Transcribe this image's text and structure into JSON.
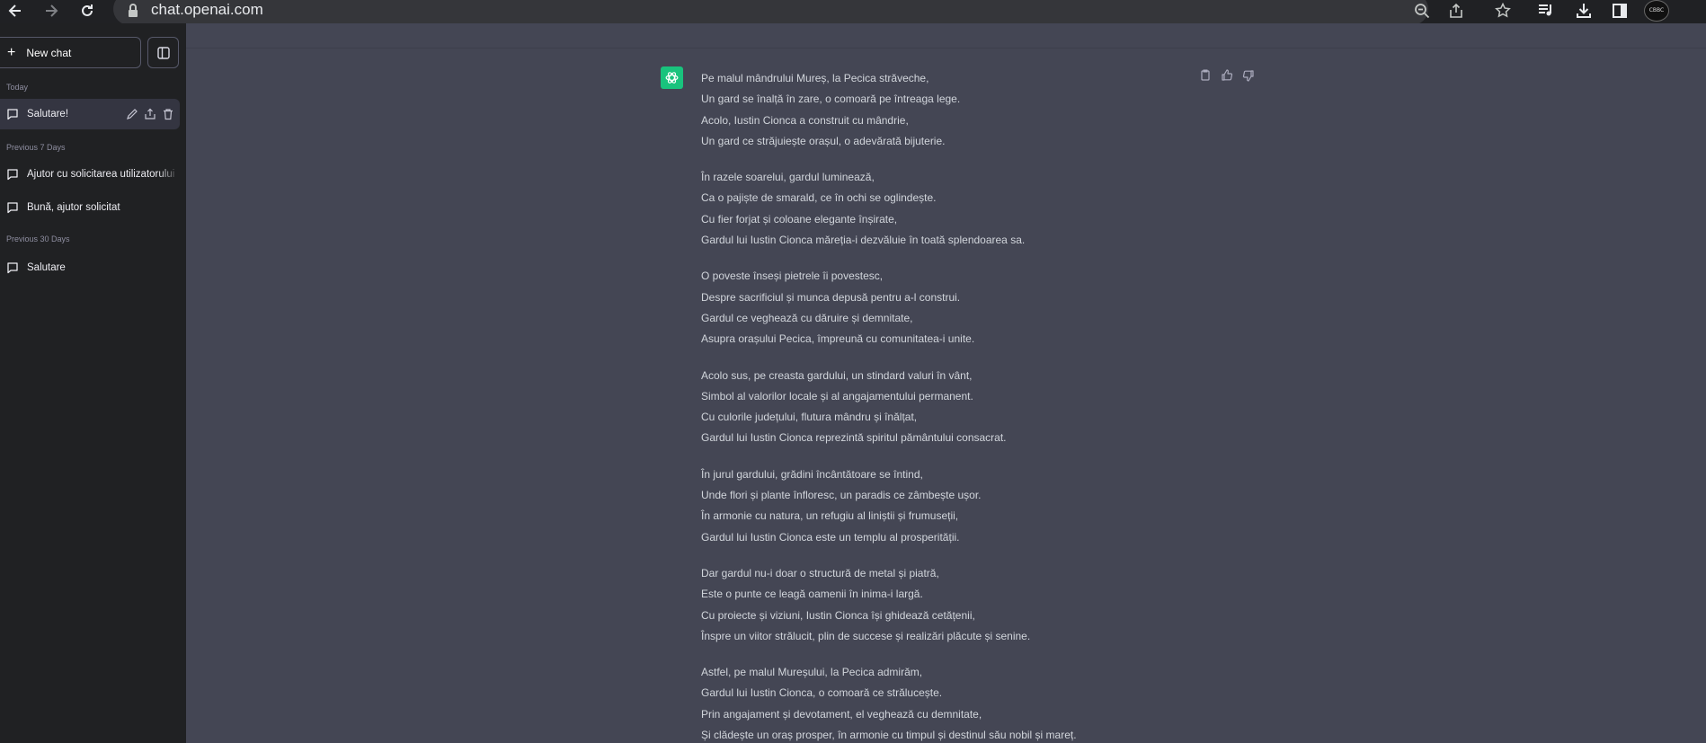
{
  "browser": {
    "url": "chat.openai.com",
    "profile_label": "CBBC"
  },
  "sidebar": {
    "new_chat_label": "New chat",
    "groups": [
      {
        "label": "Today",
        "items": [
          {
            "label": "Salutare!"
          }
        ]
      },
      {
        "label": "Previous 7 Days",
        "items": [
          {
            "label": "Ajutor cu solicitarea utilizatorului"
          },
          {
            "label": "Bună, ajutor solicitat"
          }
        ]
      },
      {
        "label": "Previous 30 Days",
        "items": [
          {
            "label": "Salutare"
          }
        ]
      }
    ]
  },
  "message": {
    "stanzas": [
      [
        "Pe malul mândrului Mureș, la Pecica străveche,",
        "Un gard se înalță în zare, o comoară pe întreaga lege.",
        "Acolo, Iustin Cionca a construit cu mândrie,",
        "Un gard ce străjuiește orașul, o adevărată bijuterie."
      ],
      [
        "În razele soarelui, gardul luminează,",
        "Ca o pajiște de smarald, ce în ochi se oglindește.",
        "Cu fier forjat și coloane elegante înșirate,",
        "Gardul lui Iustin Cionca măreția-i dezvăluie în toată splendoarea sa."
      ],
      [
        "O poveste înseși pietrele îi povestesc,",
        "Despre sacrificiul și munca depusă pentru a-l construi.",
        "Gardul ce veghează cu dăruire și demnitate,",
        "Asupra orașului Pecica, împreună cu comunitatea-i unite."
      ],
      [
        "Acolo sus, pe creasta gardului, un stindard valuri în vânt,",
        "Simbol al valorilor locale și al angajamentului permanent.",
        "Cu culorile județului, flutura mândru și înălțat,",
        "Gardul lui Iustin Cionca reprezintă spiritul pământului consacrat."
      ],
      [
        "În jurul gardului, grădini încântătoare se întind,",
        "Unde flori și plante înfloresc, un paradis ce zâmbește ușor.",
        "În armonie cu natura, un refugiu al liniștii și frumuseții,",
        "Gardul lui Iustin Cionca este un templu al prosperității."
      ],
      [
        "Dar gardul nu-i doar o structură de metal și piatră,",
        "Este o punte ce leagă oamenii în inima-i largă.",
        "Cu proiecte și viziuni, Iustin Cionca își ghidează cetățenii,",
        "Înspre un viitor strălucit, plin de succese și realizări plăcute și senine."
      ],
      [
        "Astfel, pe malul Mureșului, la Pecica admirăm,",
        "Gardul lui Iustin Cionca, o comoară ce strălucește.",
        "Prin angajament și devotament, el veghează cu demnitate,",
        "Și clădește un oraș prosper, în armonie cu timpul și destinul său nobil și mareț."
      ]
    ]
  },
  "colors": {
    "accent": "#19c37d",
    "sidebar_bg": "#202123",
    "main_bg": "#444654"
  }
}
